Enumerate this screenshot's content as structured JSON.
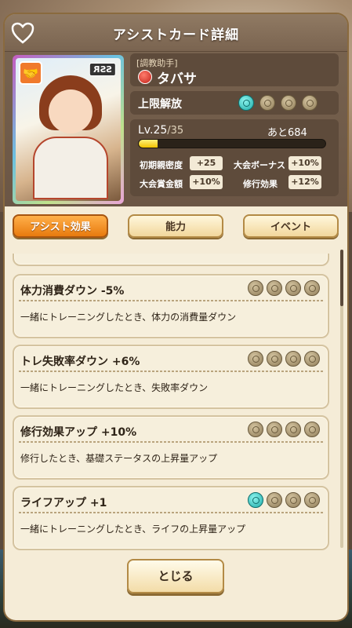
{
  "title": "アシストカード詳細",
  "card": {
    "rarity": "SSR",
    "type_glyph": "🤝",
    "role": "[調教助手]",
    "name": "タバサ"
  },
  "limit_break": {
    "label": "上限解放",
    "unlocked": 1,
    "total": 4
  },
  "level": {
    "label": "Lv.25",
    "max": "/35",
    "next": "あと684",
    "progress": 0.1
  },
  "stats": [
    {
      "label": "初期親密度",
      "value": "+25"
    },
    {
      "label": "大会ボーナス",
      "value": "+10%"
    },
    {
      "label": "大会賞金額",
      "value": "+10%"
    },
    {
      "label": "修行効果",
      "value": "+12%"
    }
  ],
  "tabs": [
    {
      "label": "アシスト効果",
      "active": true
    },
    {
      "label": "能力",
      "active": false
    },
    {
      "label": "イベント",
      "active": false
    }
  ],
  "effects": [
    {
      "name": "体力消費ダウン -5%",
      "desc": "一緒にトレーニングしたとき、体力の消費量ダウン",
      "active_coins": 0
    },
    {
      "name": "トレ失敗率ダウン +6%",
      "desc": "一緒にトレーニングしたとき、失敗率ダウン",
      "active_coins": 0
    },
    {
      "name": "修行効果アップ +10%",
      "desc": "修行したとき、基礎ステータスの上昇量アップ",
      "active_coins": 0
    },
    {
      "name": "ライフアップ +1",
      "desc": "一緒にトレーニングしたとき、ライフの上昇量アップ",
      "active_coins": 1
    }
  ],
  "close_label": "とじる",
  "colors": {
    "tab_active": "#e87a0e",
    "coin_active": "#1ca9a6",
    "exp_fill": "#f2c300"
  }
}
